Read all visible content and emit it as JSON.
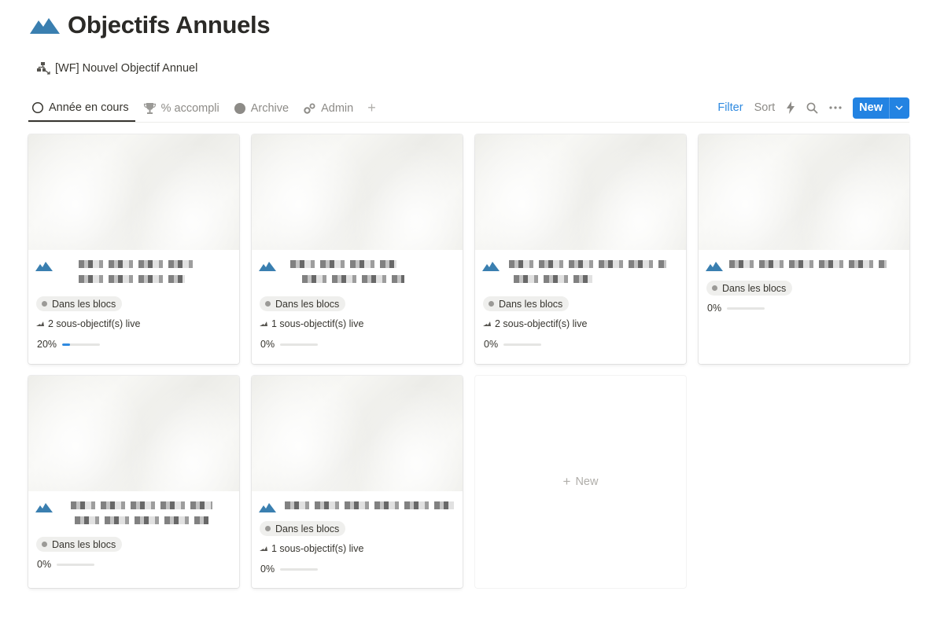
{
  "page": {
    "title": "Objectifs Annuels",
    "icon": "mountain-icon",
    "accent": "#3a7fb0"
  },
  "template": {
    "label": "[WF] Nouvel Objectif Annuel",
    "icon": "template-icon"
  },
  "tabs": [
    {
      "label": "Année en cours",
      "icon": "circle-outline-icon",
      "active": true
    },
    {
      "label": "% accompli",
      "icon": "trophy-icon",
      "active": false
    },
    {
      "label": "Archive",
      "icon": "circle-filled-icon",
      "active": false
    },
    {
      "label": "Admin",
      "icon": "gears-icon",
      "active": false
    }
  ],
  "toolbar": {
    "filter": "Filter",
    "sort": "Sort",
    "new": "New",
    "filter_color": "#2f8ae0",
    "new_color": "#2383e2"
  },
  "cards": [
    {
      "tag": "Dans les blocs",
      "subgoals": "2 sous-objectif(s) live",
      "progress_label": "20%",
      "progress": 0.2
    },
    {
      "tag": "Dans les blocs",
      "subgoals": "1 sous-objectif(s) live",
      "progress_label": "0%",
      "progress": 0
    },
    {
      "tag": "Dans les blocs",
      "subgoals": "2 sous-objectif(s) live",
      "progress_label": "0%",
      "progress": 0
    },
    {
      "tag": "Dans les blocs",
      "subgoals": "",
      "progress_label": "0%",
      "progress": 0
    },
    {
      "tag": "Dans les blocs",
      "subgoals": "",
      "progress_label": "0%",
      "progress": 0
    },
    {
      "tag": "Dans les blocs",
      "subgoals": "1 sous-objectif(s) live",
      "progress_label": "0%",
      "progress": 0
    }
  ],
  "new_card": {
    "label": "New"
  }
}
